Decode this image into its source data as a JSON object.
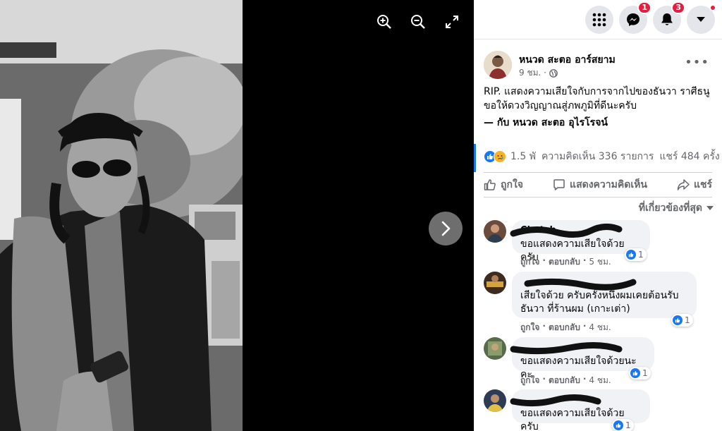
{
  "viewer": {
    "zoom_in_icon": "zoom-in-icon",
    "zoom_out_icon": "zoom-out-icon",
    "fullscreen_icon": "fullscreen-icon",
    "next_icon": "chevron-right-icon"
  },
  "topbar": {
    "messenger_badge": "1",
    "notifications_badge": "3"
  },
  "post": {
    "author": "หนวด สะตอ อาร์สยาม",
    "time": "9 ชม. ·",
    "text_line1": "RIP. แสดงความเสียใจกับการจากไปของธันวา ราศีธนู",
    "text_line2": "ขอให้ดวงวิญญาณสู่ภพภูมิที่ดีนะครับ",
    "tag_prefix": "— กับ ",
    "tag_name": "หนวด สะตอ อุไรโรจน์",
    "reaction_count": "1.5 พั",
    "comment_count": "ความคิดเห็น 336 รายการ",
    "share_count": "แชร์ 484 ครั้ง",
    "like_label": "ถูกใจ",
    "comment_label": "แสดงความคิดเห็น",
    "share_label": "แชร์",
    "sort_label": "ที่เกี่ยวข้องที่สุด"
  },
  "comments": [
    {
      "name": "Chatch",
      "text_lines": [
        "ขอแสดงความเสียใจด้วยครับ"
      ],
      "likes": "1",
      "like_label": "ถูกใจ",
      "reply_label": "ตอบกลับ",
      "time": "5 ชม."
    },
    {
      "name": "",
      "text_lines": [
        "เสียใจด้วย ครับครั้งหนึ่งผมเคยต้อนรับ",
        "ธันวา ที่ร้านผม (เกาะเต่า)"
      ],
      "likes": "1",
      "like_label": "ถูกใจ",
      "reply_label": "ตอบกลับ",
      "time": "4 ชม."
    },
    {
      "name": "",
      "text_lines": [
        "ขอแสดงความเสียใจด้วยนะคะ"
      ],
      "likes": "1",
      "like_label": "ถูกใจ",
      "reply_label": "ตอบกลับ",
      "time": "4 ชม."
    },
    {
      "name": "",
      "text_lines": [
        "ขอแสดงความเสียใจด้วยครับ"
      ],
      "likes": "1"
    }
  ]
}
